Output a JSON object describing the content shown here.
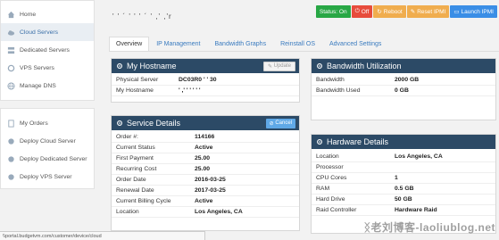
{
  "sidebar": {
    "items": [
      {
        "label": "Home",
        "icon": "home-icon"
      },
      {
        "label": "Cloud Servers",
        "icon": "cloud-icon",
        "active": true
      },
      {
        "label": "Dedicated Servers",
        "icon": "server-icon"
      },
      {
        "label": "VPS Servers",
        "icon": "vps-icon"
      },
      {
        "label": "Manage DNS",
        "icon": "globe-icon"
      }
    ],
    "items2": [
      {
        "label": "My Orders",
        "icon": "orders-icon"
      },
      {
        "label": "Deploy Cloud Server",
        "icon": "deploy-cloud-icon"
      },
      {
        "label": "Deploy Dedicated Server",
        "icon": "deploy-dedicated-icon"
      },
      {
        "label": "Deploy VPS Server",
        "icon": "deploy-vps-icon"
      }
    ]
  },
  "header": {
    "hostname_blurred": "' ' ´ ' ' ' ´ ' ,' ,'r"
  },
  "actions": {
    "status": "Status: On",
    "off": "Off",
    "reboot": "Reboot",
    "reset": "Reset IPMI",
    "launch": "Launch IPMI"
  },
  "tabs": [
    "Overview",
    "IP Management",
    "Bandwidth Graphs",
    "Reinstall OS",
    "Advanced Settings"
  ],
  "hostname_panel": {
    "title": "My Hostname",
    "update": "Update",
    "rows": [
      {
        "k": "Physical Server",
        "v": "DC03R0 ' ' 30"
      },
      {
        "k": "My Hostname",
        "v": "' ,' ' ' ' ' '"
      }
    ]
  },
  "service_panel": {
    "title": "Service Details",
    "cancel": "Cancel",
    "rows": [
      {
        "k": "Order #:",
        "v": "114166"
      },
      {
        "k": "Current Status",
        "v": "Active"
      },
      {
        "k": "First Payment",
        "v": "25.00"
      },
      {
        "k": "Recurring Cost",
        "v": "25.00"
      },
      {
        "k": "Order Date",
        "v": "2016-03-25"
      },
      {
        "k": "Renewal Date",
        "v": "2017-03-25"
      },
      {
        "k": "Current Billing Cycle",
        "v": "Active"
      },
      {
        "k": "Location",
        "v": "Los Angeles, CA"
      }
    ]
  },
  "bandwidth_panel": {
    "title": "Bandwidth Utilization",
    "rows": [
      {
        "k": "Bandwidth",
        "v": "2000 GB"
      },
      {
        "k": "Bandwidth Used",
        "v": "0 GB"
      }
    ]
  },
  "hardware_panel": {
    "title": "Hardware Details",
    "rows": [
      {
        "k": "Location",
        "v": "Los Angeles, CA"
      },
      {
        "k": "Processor",
        "v": ""
      },
      {
        "k": "CPU Cores",
        "v": "1"
      },
      {
        "k": "RAM",
        "v": "0.5 GB"
      },
      {
        "k": "Hard Drive",
        "v": "50 GB"
      },
      {
        "k": "Raid Controller",
        "v": "Hardware Raid"
      }
    ]
  },
  "statusbar": {
    "url": "\\\\portal.budgetvm.com/customer/device/cloud"
  },
  "watermark": "ᛝ老刘博客-laoliublog.net",
  "colors": {
    "panel_header": "#2c4a66",
    "link": "#3a7bbf",
    "status_on": "#28a745",
    "off": "#e74c3c",
    "reboot": "#f0ad4e",
    "launch": "#3a8ee6"
  }
}
